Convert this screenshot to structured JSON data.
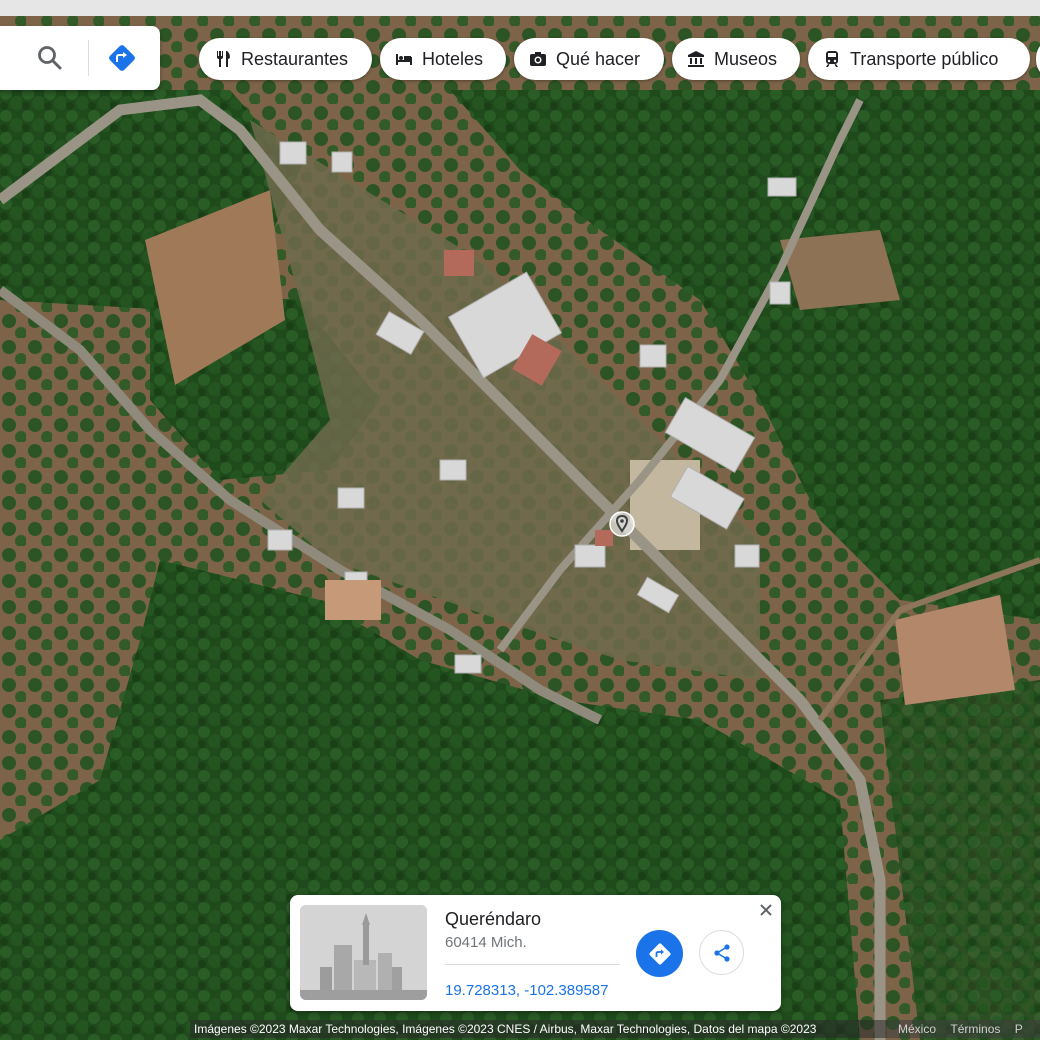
{
  "search": {
    "search_icon": "search-icon",
    "directions_icon": "directions-icon"
  },
  "chips": [
    {
      "label": "Restaurantes",
      "icon": "fork-knife-icon"
    },
    {
      "label": "Hoteles",
      "icon": "bed-icon"
    },
    {
      "label": "Qué hacer",
      "icon": "camera-icon"
    },
    {
      "label": "Museos",
      "icon": "museum-icon"
    },
    {
      "label": "Transporte público",
      "icon": "train-icon"
    }
  ],
  "card": {
    "title": "Queréndaro",
    "subtitle": "60414 Mich.",
    "coords": "19.728313, -102.389587",
    "route_icon": "directions-icon",
    "share_icon": "share-icon",
    "close_icon": "close-icon"
  },
  "footer": {
    "attribution": "Imágenes ©2023 Maxar Technologies, Imágenes ©2023 CNES / Airbus, Maxar Technologies, Datos del mapa ©2023",
    "country": "México",
    "terms": "Términos",
    "extra": "P"
  },
  "colors": {
    "accent": "#1a73e8",
    "forest": "#1f4a1c",
    "soil": "#8a6a4a",
    "road": "#9a9486"
  }
}
